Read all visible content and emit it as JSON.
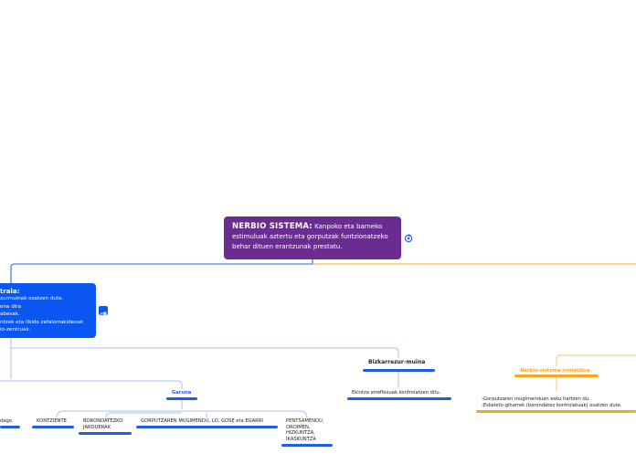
{
  "root": {
    "title": "NERBIO SISTEMA:",
    "line1": "Kanpoko eta barneko",
    "line2": "estimuluak aztertu eta gorputzak funtzionatzeko",
    "line3": "behar dituen erantzunak prestatu."
  },
  "central": {
    "title": "trala:",
    "lines": [
      "zurmuinak osatzen dute.",
      "ena dira",
      "abesak.",
      "ntzek eta likido zefalorrakideoak",
      "io-zentruak."
    ]
  },
  "garuna": {
    "label": "Garuna",
    "children": [
      "dago.",
      "KONTZIENTE",
      "BORONDATEZKO JARDUERAK",
      "GORPUTZAREN MUGIMENDU, LO, GOSE eta EGARRI",
      "PENTSAMENDU, OROIMEN, HIZKUNTZA, IKASKUNTZA"
    ]
  },
  "bizkarrezur": {
    "label": "Bizkarrezur-muina",
    "child": "Ekintza erreflexuak kontrolatzen ditu."
  },
  "somatikoa": {
    "label": "Nerbio-sistema somatikoa",
    "line1": "-Gorputzaren mugimenduan esku hartzen du.",
    "line2": "-Eskeleto-giharrek (borondatez kontrolatuak) osatzen dute."
  },
  "colors": {
    "root": "#6a2c91",
    "central": "#0a56f0",
    "orange": "#f5a623",
    "blue_line": "#1e5ee6",
    "connector_blue": "#a9c1f5",
    "connector_orange": "#f7c36b"
  },
  "icons": [
    "link-icon",
    "external-link-icon"
  ]
}
